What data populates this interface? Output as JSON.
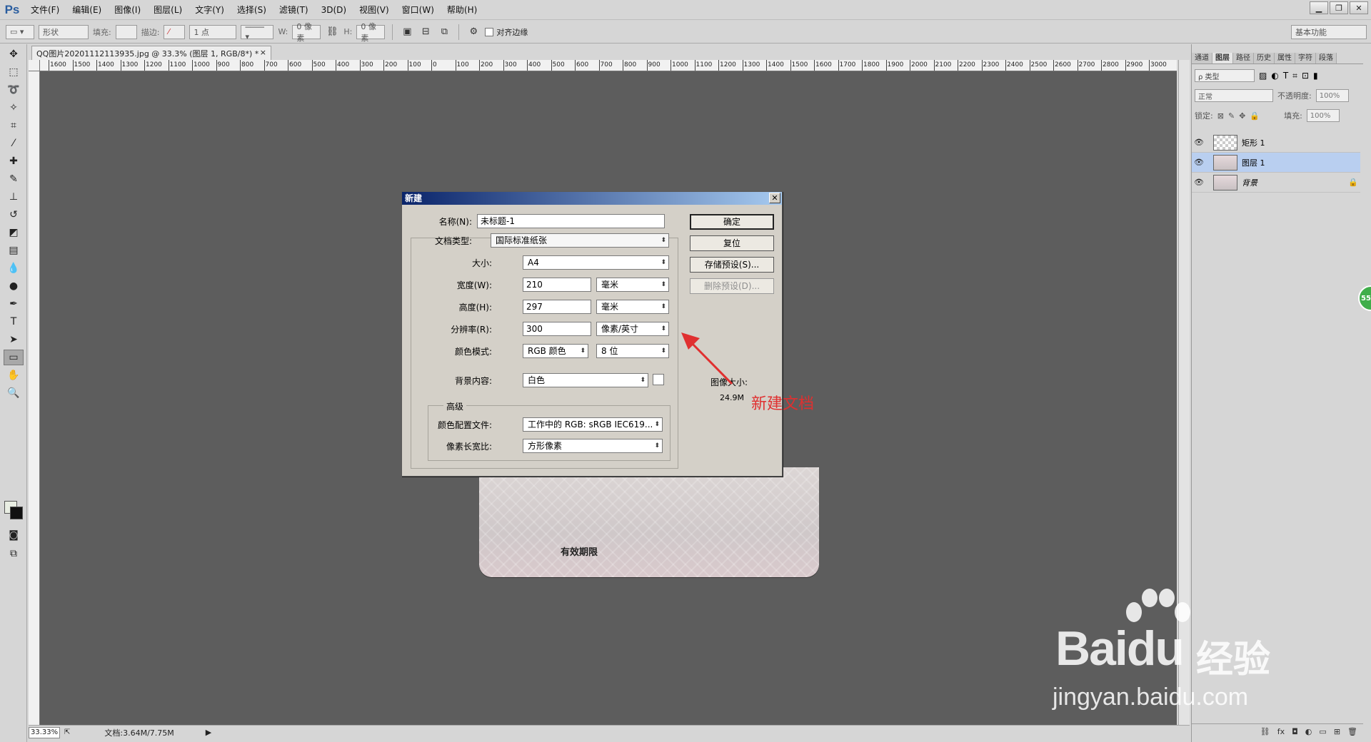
{
  "app": {
    "logo": "Ps"
  },
  "menu": [
    "文件(F)",
    "编辑(E)",
    "图像(I)",
    "图层(L)",
    "文字(Y)",
    "选择(S)",
    "滤镜(T)",
    "3D(D)",
    "视图(V)",
    "窗口(W)",
    "帮助(H)"
  ],
  "options": {
    "mode": "形状",
    "fill_label": "填充:",
    "stroke_label": "描边:",
    "stroke_width": "1 点",
    "w_label": "W:",
    "w_value": "0 像素",
    "h_label": "H:",
    "h_value": "0 像素",
    "align_edges": "对齐边缘",
    "workspace": "基本功能"
  },
  "document": {
    "tab_title": "QQ图片20201112113935.jpg @ 33.3% (图层 1, RGB/8*) *",
    "tab_close": "×",
    "ruler_ticks": [
      "1600",
      "1500",
      "1400",
      "1300",
      "1200",
      "1100",
      "1000",
      "900",
      "800",
      "700",
      "600",
      "500",
      "400",
      "300",
      "200",
      "100",
      "0",
      "100",
      "200",
      "300",
      "400",
      "500",
      "600",
      "700",
      "800",
      "900",
      "1000",
      "1100",
      "1200",
      "1300",
      "1400",
      "1500",
      "1600",
      "1700",
      "1800",
      "1900",
      "2000",
      "2100",
      "2200",
      "2300",
      "2400",
      "2500",
      "2600",
      "2700",
      "2800",
      "2900",
      "3000"
    ],
    "photo_text": "有效期限",
    "zoom": "33.33%",
    "doc_size": "文档:3.64M/7.75M"
  },
  "dialog": {
    "title": "新建",
    "name_label": "名称(N):",
    "name_value": "未标题-1",
    "preset_label": "文档类型:",
    "preset_value": "国际标准纸张",
    "size_label": "大小:",
    "size_value": "A4",
    "width_label": "宽度(W):",
    "width_value": "210",
    "width_unit": "毫米",
    "height_label": "高度(H):",
    "height_value": "297",
    "height_unit": "毫米",
    "resolution_label": "分辨率(R):",
    "resolution_value": "300",
    "resolution_unit": "像素/英寸",
    "color_mode_label": "颜色模式:",
    "color_mode_value": "RGB 颜色",
    "bit_depth": "8 位",
    "background_label": "背景内容:",
    "background_value": "白色",
    "advanced_label": "高级",
    "profile_label": "颜色配置文件:",
    "profile_value": "工作中的 RGB: sRGB IEC619...",
    "pixel_aspect_label": "像素长宽比:",
    "pixel_aspect_value": "方形像素",
    "ok": "确定",
    "reset": "复位",
    "save_preset": "存储预设(S)...",
    "delete_preset": "删除预设(D)...",
    "image_size_label": "图像大小:",
    "image_size_value": "24.9M"
  },
  "annotation": {
    "text": "新建文档",
    "color": "#e03030"
  },
  "panels": {
    "tabs": [
      "通道",
      "图层",
      "路径",
      "历史",
      "属性",
      "字符",
      "段落"
    ],
    "active_tab": "图层",
    "filter": "ρ 类型",
    "blend_mode": "正常",
    "opacity_label": "不透明度:",
    "opacity_value": "100%",
    "lock_label": "锁定:",
    "fill_label": "填充:",
    "fill_value": "100%",
    "layers": [
      {
        "name": "矩形 1",
        "selected": false
      },
      {
        "name": "图层 1",
        "selected": true
      },
      {
        "name": "背景",
        "selected": false,
        "locked": true
      }
    ]
  },
  "badge": {
    "text": "55"
  },
  "watermark": {
    "brand": "Bai",
    "brand2": "du",
    "cn": "经验",
    "url": "jingyan.baidu.com"
  }
}
